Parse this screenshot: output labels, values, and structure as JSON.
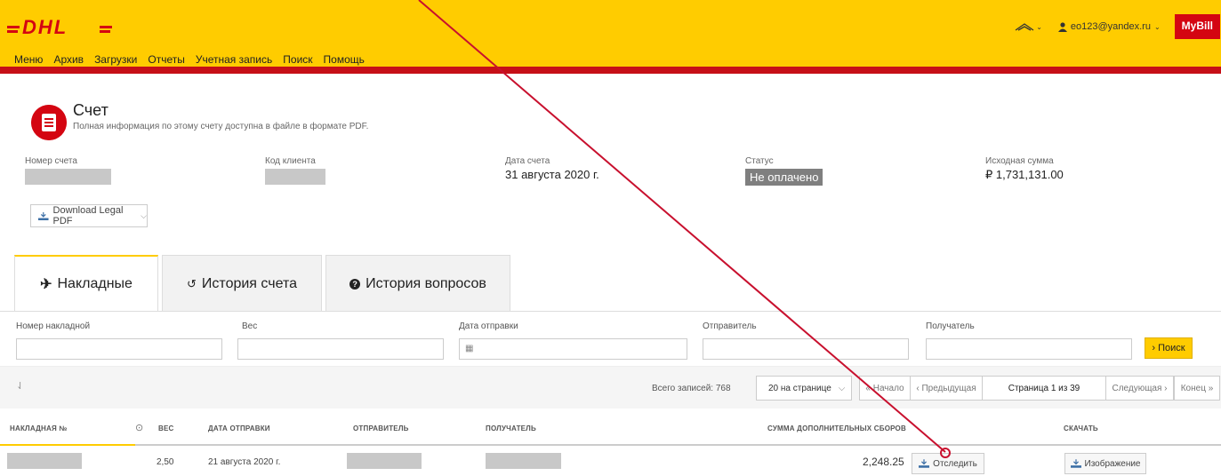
{
  "header": {
    "logo_text": "DHL",
    "nav": [
      "Меню",
      "Архив",
      "Загрузки",
      "Отчеты",
      "Учетная запись",
      "Поиск",
      "Помощь"
    ],
    "user_email": "eo123@yandex.ru",
    "mybill": "MyBill"
  },
  "invoice": {
    "title": "Счет",
    "subtitle": "Полная информация по этому счету доступна в файле в формате PDF.",
    "number_label": "Номер счета",
    "client_label": "Код клиента",
    "date_label": "Дата счета",
    "date_value": "31 августа 2020 г.",
    "status_label": "Статус",
    "status_value": "Не оплачено",
    "amount_label": "Исходная сумма",
    "amount_value": "₽ 1,731,131.00",
    "download_label": "Download Legal PDF"
  },
  "tabs": [
    {
      "label": "Накладные",
      "icon": "plane-icon"
    },
    {
      "label": "История счета",
      "icon": "history-icon"
    },
    {
      "label": "История вопросов",
      "icon": "question-icon"
    }
  ],
  "filters": {
    "waybill": "Номер накладной",
    "weight": "Вес",
    "ship_date": "Дата отправки",
    "sender": "Отправитель",
    "receiver": "Получатель",
    "search": "Поиск"
  },
  "pager": {
    "total": "Всего записей: 768",
    "per_page": "20 на странице",
    "first": "« Начало",
    "prev": "‹ Предыдущая",
    "current": "Страница 1 из 39",
    "next": "Следующая ›",
    "last": "Конец »"
  },
  "table": {
    "headers": [
      "НАКЛАДНАЯ №",
      "ВЕС",
      "ДАТА ОТПРАВКИ",
      "ОТПРАВИТЕЛЬ",
      "ПОЛУЧАТЕЛЬ",
      "СУММА ДОПОЛНИТЕЛЬНЫХ СБОРОВ",
      "СКАЧАТЬ"
    ],
    "row": {
      "weight": "2,50",
      "date": "21 августа 2020 г.",
      "amount": "2,248.25",
      "track": "Отследить",
      "image": "Изображение"
    }
  },
  "colors": {
    "dhl_yellow": "#ffcc00",
    "dhl_red": "#d40511",
    "annotation": "#c8102e"
  }
}
